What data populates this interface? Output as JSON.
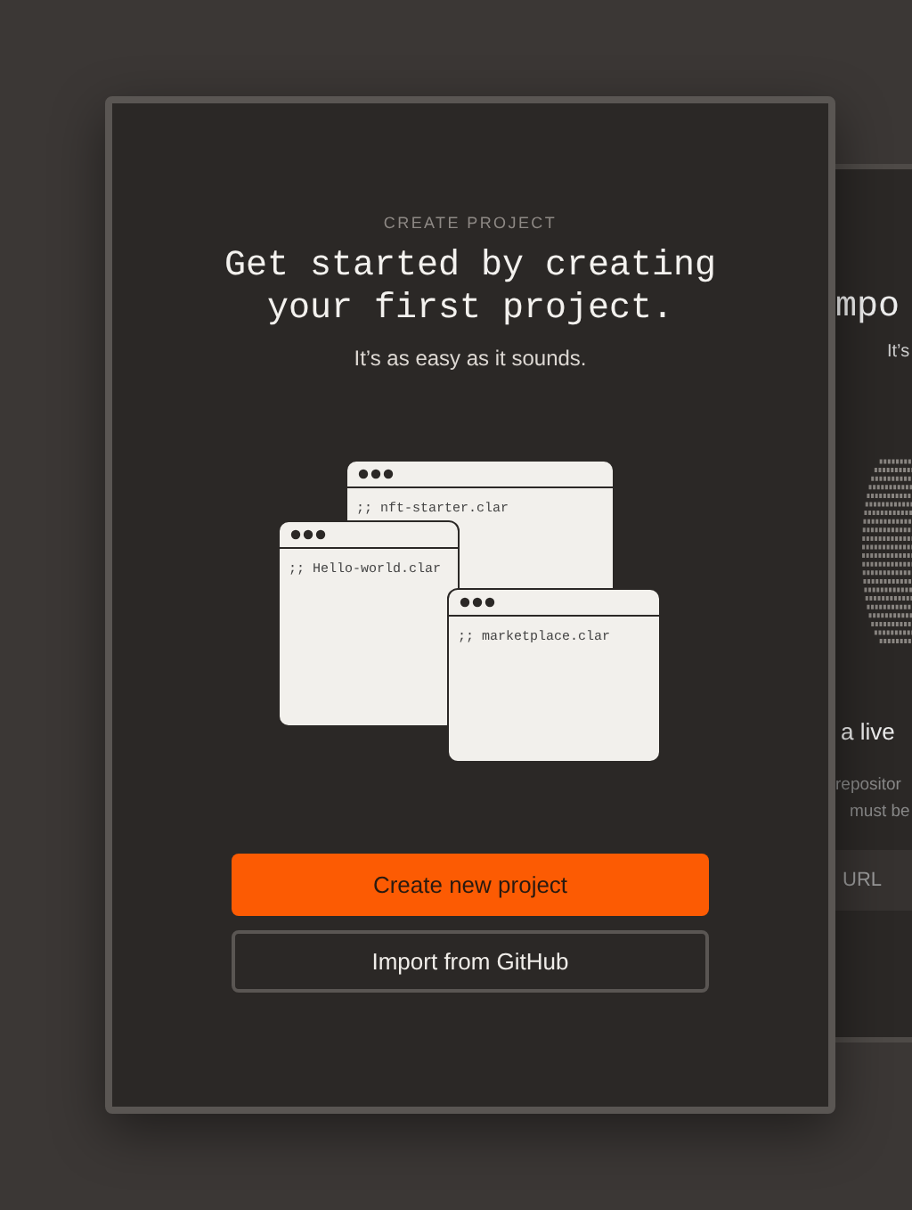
{
  "back_card": {
    "title": "mpo",
    "subtitle": "It’s",
    "heading": "a live",
    "description_lines": [
      "repositor",
      "must be"
    ],
    "url_field": {
      "placeholder": "URL"
    }
  },
  "card": {
    "eyebrow": "CREATE PROJECT",
    "title": "Get started by creating your first project.",
    "subtitle": "It’s as easy as it sounds.",
    "files": [
      {
        "name": ";; nft-starter.clar"
      },
      {
        "name": ";; Hello-world.clar"
      },
      {
        "name": ";; marketplace.clar"
      }
    ],
    "buttons": [
      {
        "label": "Create new project",
        "kind": "primary"
      },
      {
        "label": "Import from GitHub",
        "kind": "secondary"
      }
    ]
  }
}
